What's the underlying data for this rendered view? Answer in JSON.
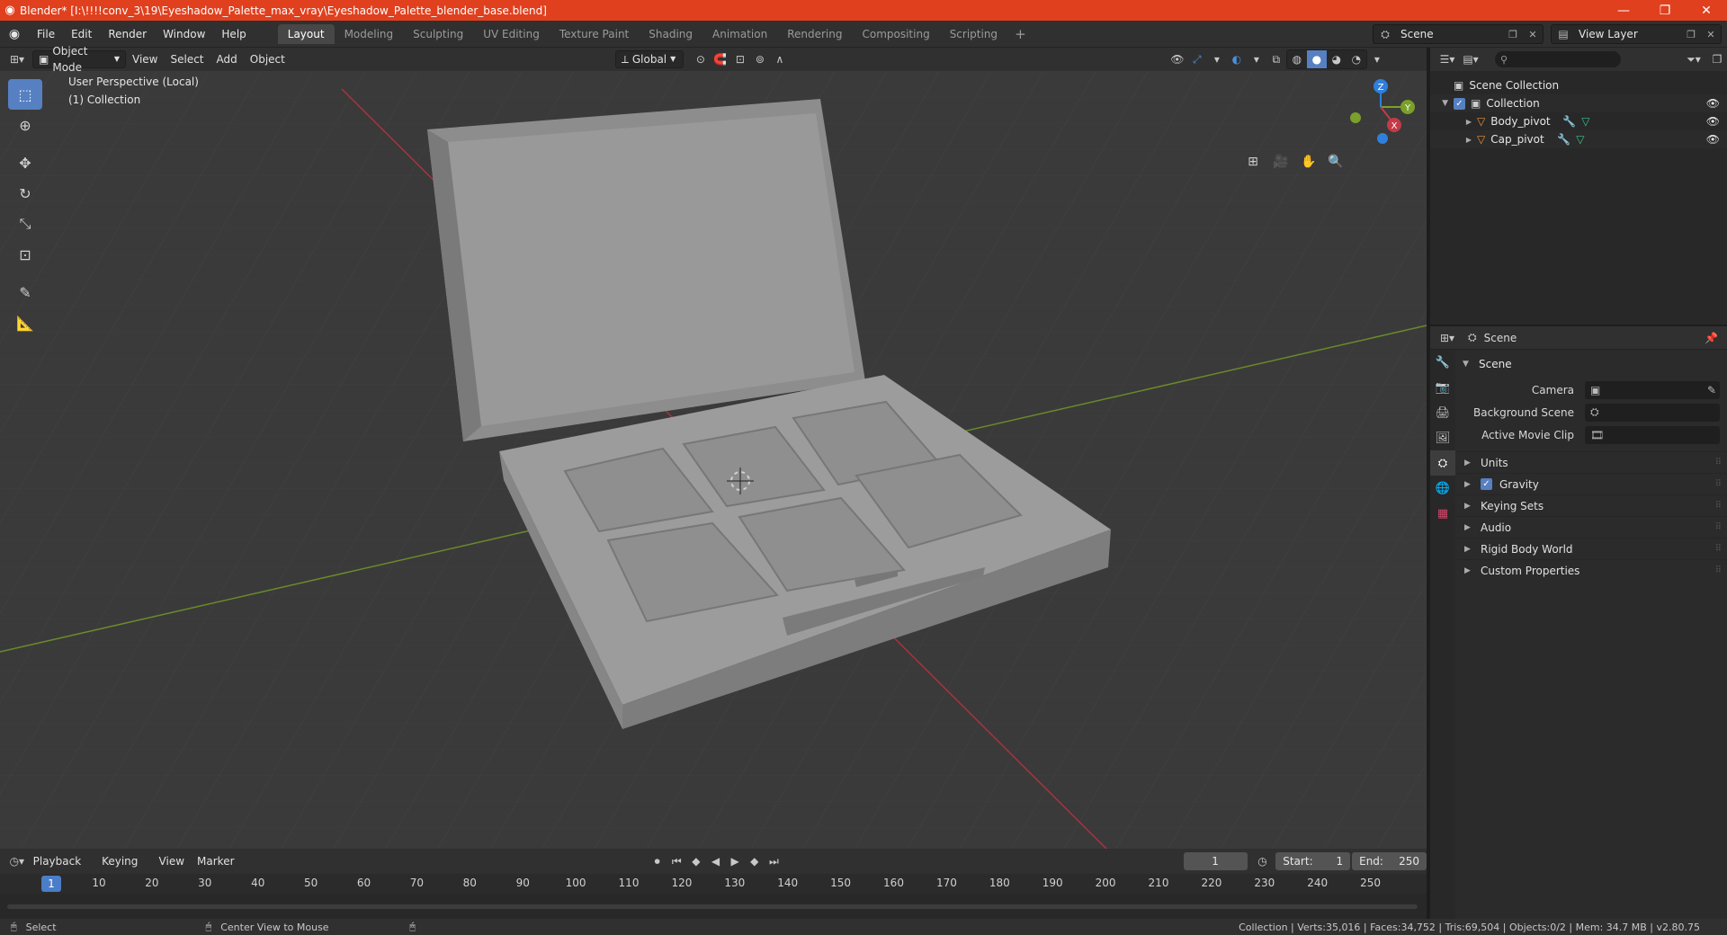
{
  "window": {
    "title": "Blender* [I:\\!!!!conv_3\\19\\Eyeshadow_Palette_max_vray\\Eyeshadow_Palette_blender_base.blend]"
  },
  "menu": [
    "File",
    "Edit",
    "Render",
    "Window",
    "Help"
  ],
  "workspaces": [
    "Layout",
    "Modeling",
    "Sculpting",
    "UV Editing",
    "Texture Paint",
    "Shading",
    "Animation",
    "Rendering",
    "Compositing",
    "Scripting"
  ],
  "active_workspace": "Layout",
  "scene_selector": {
    "label": "Scene"
  },
  "view_layer_selector": {
    "label": "View Layer"
  },
  "viewport_header": {
    "mode": "Object Mode",
    "menus": [
      "View",
      "Select",
      "Add",
      "Object"
    ],
    "transform_orientation": "Global"
  },
  "viewport": {
    "perspective_label": "User Perspective (Local)",
    "collection_label": "(1) Collection",
    "gizmo_axes": {
      "x": "X",
      "y": "Y",
      "z": "Z"
    }
  },
  "outliner": {
    "root": "Scene Collection",
    "collection": "Collection",
    "objects": [
      "Body_pivot",
      "Cap_pivot"
    ]
  },
  "properties": {
    "header_title": "Scene",
    "panel_title": "Scene",
    "fields": [
      {
        "label": "Camera",
        "value": ""
      },
      {
        "label": "Background Scene",
        "value": ""
      },
      {
        "label": "Active Movie Clip",
        "value": ""
      }
    ],
    "sub_panels": [
      {
        "label": "Units",
        "checkbox": false
      },
      {
        "label": "Gravity",
        "checkbox": true,
        "checked": true
      },
      {
        "label": "Keying Sets",
        "checkbox": false
      },
      {
        "label": "Audio",
        "checkbox": false
      },
      {
        "label": "Rigid Body World",
        "checkbox": false
      },
      {
        "label": "Custom Properties",
        "checkbox": false
      }
    ]
  },
  "timeline": {
    "menus": [
      "Playback",
      "Keying",
      "View",
      "Marker"
    ],
    "current_frame": "1",
    "start_label": "Start:",
    "start_value": "1",
    "end_label": "End:",
    "end_value": "250",
    "ruler": [
      "1",
      "10",
      "20",
      "30",
      "40",
      "50",
      "60",
      "70",
      "80",
      "90",
      "100",
      "110",
      "120",
      "130",
      "140",
      "150",
      "160",
      "170",
      "180",
      "190",
      "200",
      "210",
      "220",
      "230",
      "240",
      "250"
    ]
  },
  "status_bar": {
    "left_action": "Select",
    "middle_action": "Center View to Mouse",
    "stats": "Collection | Verts:35,016 | Faces:34,752 | Tris:69,504 | Objects:0/2 | Mem: 34.7 MB | v2.80.75"
  },
  "colors": {
    "titlebar": "#e0401e",
    "accent_blue": "#5680c2",
    "x_axis": "#c43a48",
    "y_axis": "#7aa02a",
    "z_axis": "#2f7fdc",
    "object_icon": "#e8913a",
    "modifier_icon": "#5aa0e0",
    "mesh_data_icon": "#3cc48e"
  }
}
